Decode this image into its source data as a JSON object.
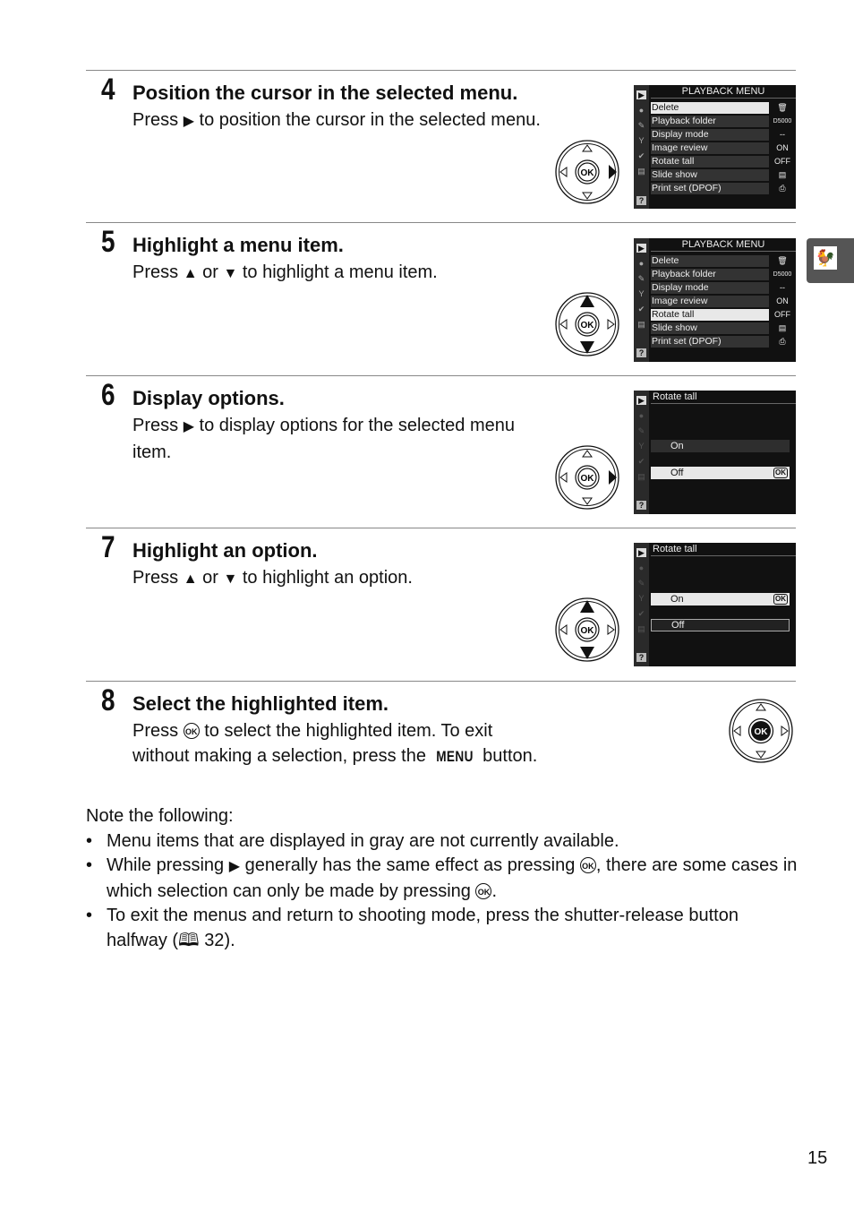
{
  "steps": [
    {
      "number": "4",
      "title": "Position the cursor in the selected menu.",
      "body_before": "Press ",
      "body_icon": "right-arrow",
      "body_after": " to position the cursor in the selected menu.",
      "dial_active": "right",
      "screen": {
        "type": "menu",
        "header": "PLAYBACK MENU",
        "selected_index": 0,
        "items": [
          {
            "label": "Delete",
            "value": "🗑"
          },
          {
            "label": "Playback folder",
            "value": "D5000"
          },
          {
            "label": "Display mode",
            "value": "--"
          },
          {
            "label": "Image review",
            "value": "ON"
          },
          {
            "label": "Rotate tall",
            "value": "OFF"
          },
          {
            "label": "Slide show",
            "value": "▤"
          },
          {
            "label": "Print set (DPOF)",
            "value": "⎙"
          }
        ]
      }
    },
    {
      "number": "5",
      "title": "Highlight a menu item.",
      "body_before": "Press ",
      "body_icon": "up-arrow",
      "body_mid": " or ",
      "body_icon2": "down-arrow",
      "body_after": " to highlight a menu item.",
      "dial_active": "updown",
      "screen": {
        "type": "menu",
        "header": "PLAYBACK MENU",
        "selected_index": 4,
        "items": [
          {
            "label": "Delete",
            "value": "🗑"
          },
          {
            "label": "Playback folder",
            "value": "D5000"
          },
          {
            "label": "Display mode",
            "value": "--"
          },
          {
            "label": "Image review",
            "value": "ON"
          },
          {
            "label": "Rotate tall",
            "value": "OFF"
          },
          {
            "label": "Slide show",
            "value": "▤"
          },
          {
            "label": "Print set (DPOF)",
            "value": "⎙"
          }
        ]
      }
    },
    {
      "number": "6",
      "title": "Display options.",
      "body_before": "Press ",
      "body_icon": "right-arrow",
      "body_after": " to display options for the selected menu item.",
      "dial_active": "right",
      "screen": {
        "type": "options",
        "header": "Rotate tall",
        "options": [
          "On",
          "Off"
        ],
        "highlighted": 1,
        "current": 1,
        "ok_badge": "OK"
      }
    },
    {
      "number": "7",
      "title": "Highlight an option.",
      "body_before": "Press ",
      "body_icon": "up-arrow",
      "body_mid": " or ",
      "body_icon2": "down-arrow",
      "body_after": " to highlight an option.",
      "dial_active": "updown",
      "screen": {
        "type": "options",
        "header": "Rotate tall",
        "options": [
          "On",
          "Off"
        ],
        "highlighted": 0,
        "current": 1,
        "ok_badge": "OK"
      }
    },
    {
      "number": "8",
      "title": "Select the highlighted item.",
      "body_before": "Press ",
      "body_icon": "ok",
      "body_after": " to select the highlighted item.  To exit without making a selection, press the ",
      "menu_word": "MENU",
      "body_end": " button.",
      "dial_active": "ok"
    }
  ],
  "glyphs": {
    "right": "▶",
    "up": "▲",
    "down": "▼",
    "ok": "OK",
    "book": "🕮"
  },
  "notes": {
    "intro": "Note the following:",
    "items": [
      {
        "text": "Menu items that are displayed in gray are not currently available."
      },
      {
        "t1": "While pressing ",
        "t2": " generally has the same effect as pressing ",
        "t3": ", there are some cases in which selection can only be made by pressing ",
        "t4": "."
      },
      {
        "t1": "To exit the menus and return to shooting mode, press the shutter-release button halfway (",
        "ref": "32",
        "t2": ")."
      }
    ]
  },
  "side_tab": {
    "icon": "weathervane-icon",
    "glyph": "🐓"
  },
  "page_number": "15",
  "screen_sidebar": [
    "▶",
    "●",
    "✎",
    "Y",
    "✔",
    "▤",
    "?"
  ]
}
